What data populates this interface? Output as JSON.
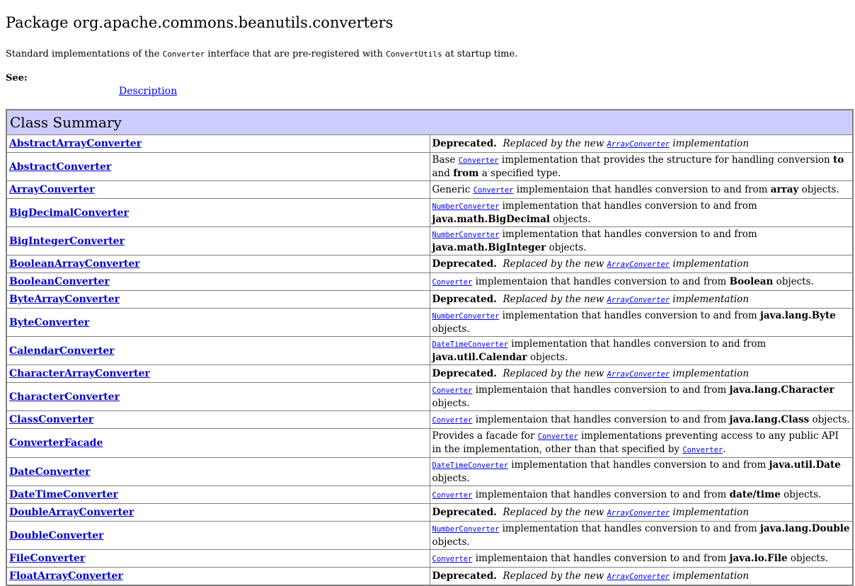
{
  "page": {
    "title": "Package org.apache.commons.beanutils.converters",
    "intro_pre": "Standard implementations of the ",
    "intro_code1": "Converter",
    "intro_mid": " interface that are pre-registered with ",
    "intro_code2": "ConvertUtils",
    "intro_post": " at startup time.",
    "see_label": "See:",
    "description_link": "Description"
  },
  "summary": {
    "heading": "Class Summary",
    "rows": [
      {
        "name": "AbstractArrayConverter",
        "kind": "deprecated",
        "deprecated": "Deprecated.",
        "pre": "Replaced by the new ",
        "link": "ArrayConverter",
        "post": " implementation"
      },
      {
        "name": "AbstractConverter",
        "kind": "b2",
        "pre": "Base ",
        "link": "Converter",
        "mid": " implementation that provides the structure for handling conversion ",
        "bold1": "to",
        "mid2": " and ",
        "bold2": "from",
        "post": " a specified type."
      },
      {
        "name": "ArrayConverter",
        "kind": "b1",
        "pre": "Generic ",
        "link": "Converter",
        "mid": " implementaion that handles conversion to and from ",
        "bold": "array",
        "post": " objects."
      },
      {
        "name": "BigDecimalConverter",
        "kind": "b1",
        "pre": "",
        "link": "NumberConverter",
        "mid": " implementation that handles conversion to and from ",
        "bold": "java.math.BigDecimal",
        "post": " objects."
      },
      {
        "name": "BigIntegerConverter",
        "kind": "b1",
        "pre": "",
        "link": "NumberConverter",
        "mid": " implementation that handles conversion to and from ",
        "bold": "java.math.BigInteger",
        "post": " objects."
      },
      {
        "name": "BooleanArrayConverter",
        "kind": "deprecated",
        "deprecated": "Deprecated.",
        "pre": "Replaced by the new ",
        "link": "ArrayConverter",
        "post": " implementation"
      },
      {
        "name": "BooleanConverter",
        "kind": "b1",
        "pre": "",
        "link": "Converter",
        "mid": " implementaion that handles conversion to and from ",
        "bold": "Boolean",
        "post": " objects."
      },
      {
        "name": "ByteArrayConverter",
        "kind": "deprecated",
        "deprecated": "Deprecated.",
        "pre": "Replaced by the new ",
        "link": "ArrayConverter",
        "post": " implementation"
      },
      {
        "name": "ByteConverter",
        "kind": "b1",
        "pre": "",
        "link": "NumberConverter",
        "mid": " implementation that handles conversion to and from ",
        "bold": "java.lang.Byte",
        "post": " objects."
      },
      {
        "name": "CalendarConverter",
        "kind": "b1",
        "pre": "",
        "link": "DateTimeConverter",
        "mid": " implementation that handles conversion to and from ",
        "bold": "java.util.Calendar",
        "post": " objects."
      },
      {
        "name": "CharacterArrayConverter",
        "kind": "deprecated",
        "deprecated": "Deprecated.",
        "pre": "Replaced by the new ",
        "link": "ArrayConverter",
        "post": " implementation"
      },
      {
        "name": "CharacterConverter",
        "kind": "b1",
        "pre": "",
        "link": "Converter",
        "mid": " implementaion that handles conversion to and from ",
        "bold": "java.lang.Character",
        "post": " objects."
      },
      {
        "name": "ClassConverter",
        "kind": "b1",
        "pre": "",
        "link": "Converter",
        "mid": " implementaion that handles conversion to and from ",
        "bold": "java.lang.Class",
        "post": " objects."
      },
      {
        "name": "ConverterFacade",
        "kind": "facade",
        "pre": "Provides a facade for ",
        "link": "Converter",
        "mid": " implementations preventing access to any public API in the implementation, other than that specified by ",
        "link2": "Converter",
        "post": "."
      },
      {
        "name": "DateConverter",
        "kind": "b1",
        "pre": "",
        "link": "DateTimeConverter",
        "mid": " implementation that handles conversion to and from ",
        "bold": "java.util.Date",
        "post": " objects."
      },
      {
        "name": "DateTimeConverter",
        "kind": "b1",
        "pre": "",
        "link": "Converter",
        "mid": " implementaion that handles conversion to and from ",
        "bold": "date/time",
        "post": " objects."
      },
      {
        "name": "DoubleArrayConverter",
        "kind": "deprecated",
        "deprecated": "Deprecated.",
        "pre": "Replaced by the new ",
        "link": "ArrayConverter",
        "post": " implementation"
      },
      {
        "name": "DoubleConverter",
        "kind": "b1",
        "pre": "",
        "link": "NumberConverter",
        "mid": " implementation that handles conversion to and from ",
        "bold": "java.lang.Double",
        "post": " objects."
      },
      {
        "name": "FileConverter",
        "kind": "b1",
        "pre": "",
        "link": "Converter",
        "mid": " implementaion that handles conversion to and from ",
        "bold": "java.io.File",
        "post": " objects."
      },
      {
        "name": "FloatArrayConverter",
        "kind": "deprecated",
        "deprecated": "Deprecated.",
        "pre": "Replaced by the new ",
        "link": "ArrayConverter",
        "post": " implementation"
      }
    ]
  }
}
